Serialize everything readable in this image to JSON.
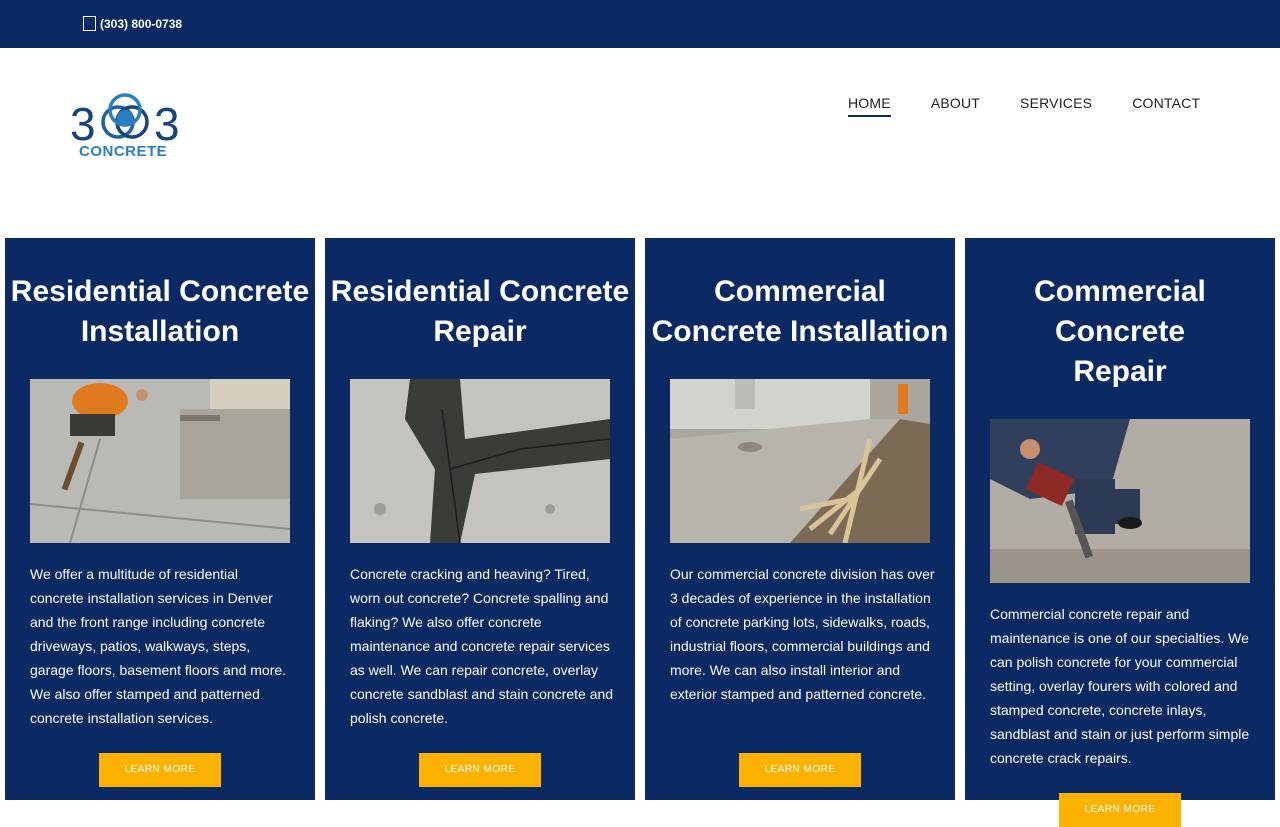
{
  "topbar": {
    "phone": "(303) 800-0738"
  },
  "logo": {
    "number": "303",
    "text": "CONCRETE"
  },
  "nav": {
    "items": [
      {
        "label": "HOME",
        "active": true
      },
      {
        "label": "ABOUT",
        "active": false
      },
      {
        "label": "SERVICES",
        "active": false
      },
      {
        "label": "CONTACT",
        "active": false
      }
    ]
  },
  "cards": [
    {
      "title_lines": [
        "Residential Concrete",
        "Installation"
      ],
      "image": "worker-smoothing-concrete-slab",
      "text": "We offer a multitude of residential concrete installation services in Denver and the front range including concrete driveways, patios, walkways, steps, garage floors, basement floors and more. We also offer stamped and patterned concrete installation services.",
      "button": "LEARN MORE"
    },
    {
      "title_lines": [
        "Residential Concrete",
        "Repair"
      ],
      "image": "sealed-concrete-crack",
      "text": "Concrete cracking and heaving? Tired, worn out concrete? Concrete spalling and flaking? We also offer concrete maintenance and concrete repair services as well. We can repair concrete, overlay concrete sandblast and stain concrete and polish concrete.",
      "button": "LEARN MORE"
    },
    {
      "title_lines": [
        "Commercial",
        "Concrete Installation"
      ],
      "image": "new-sidewalk-with-forms",
      "text": "Our commercial concrete division has over 3 decades of experience in the installation of concrete parking lots, sidewalks, roads, industrial floors, commercial buildings and more. We can also install interior and exterior stamped and patterned concrete.",
      "button": "LEARN MORE"
    },
    {
      "title_lines": [
        "Commercial",
        "Concrete",
        "Repair"
      ],
      "image": "worker-with-jackhammer",
      "text": "Commercial concrete repair and maintenance is one of our specialties. We can polish concrete for your commercial setting, overlay fourers with colored and stamped concrete, concrete inlays, sandblast and stain or just perform simple concrete crack repairs.",
      "button": "LEARN MORE"
    }
  ],
  "colors": {
    "navy": "#0b2a63",
    "accent": "#fbb100",
    "logo_blue": "#2a7fc1"
  }
}
